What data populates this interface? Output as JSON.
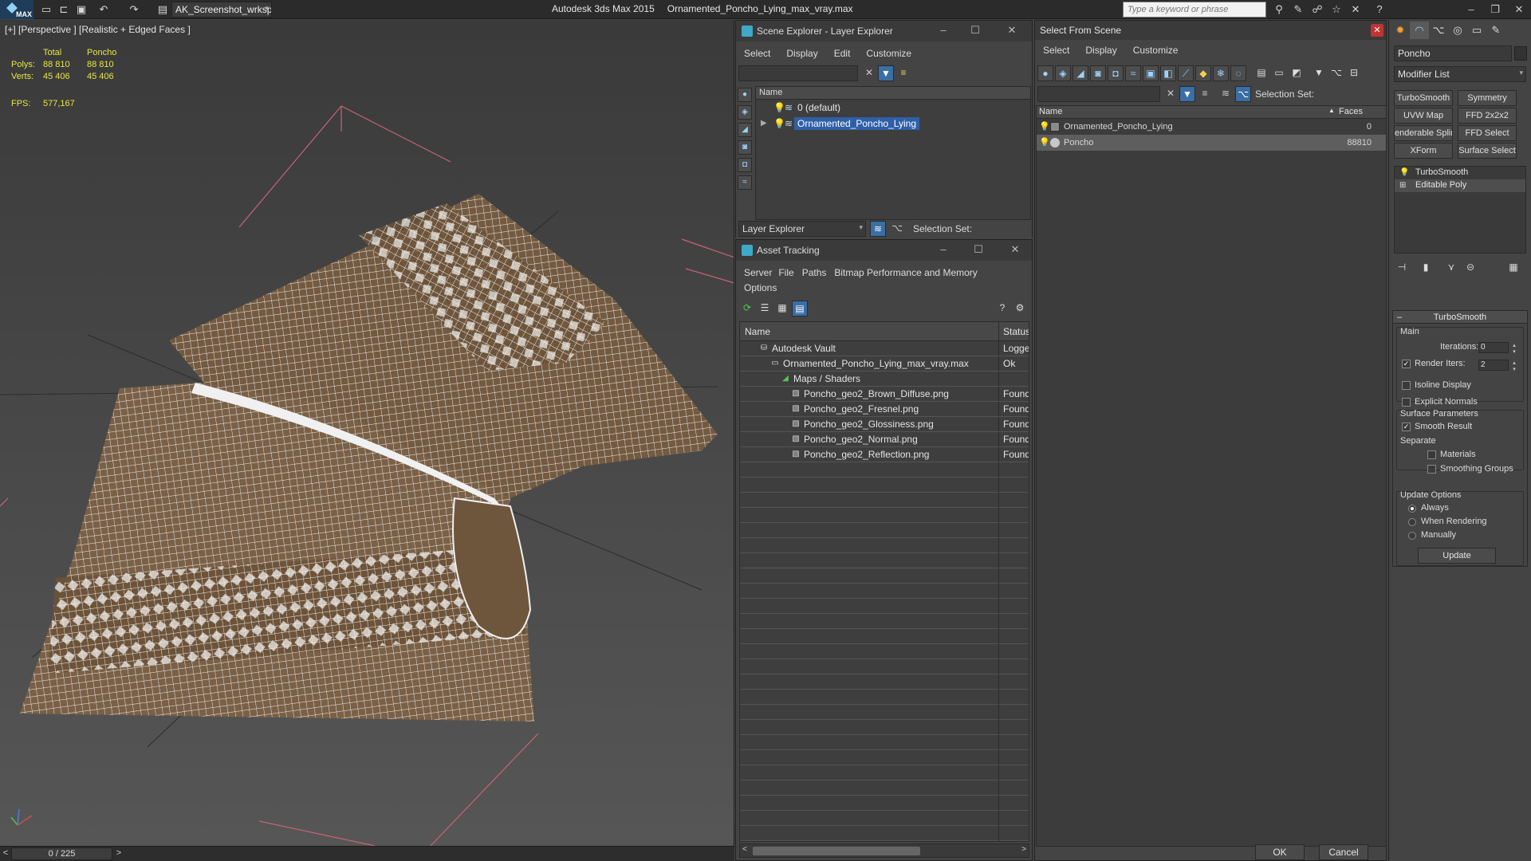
{
  "titlebar": {
    "workspace": "AK_Screenshot_wrksp",
    "app_name": "Autodesk 3ds Max  2015",
    "file_name": "Ornamented_Poncho_Lying_max_vray.max",
    "search_placeholder": "Type a keyword or phrase"
  },
  "viewport": {
    "label": "[+] [Perspective ] [Realistic + Edged Faces ]",
    "stats": {
      "col_total": "Total",
      "col_object": "Poncho",
      "polys_label": "Polys:",
      "polys_total": "88 810",
      "polys_object": "88 810",
      "verts_label": "Verts:",
      "verts_total": "45 406",
      "verts_object": "45 406",
      "fps_label": "FPS:",
      "fps_value": "577,167"
    },
    "time_slider": "0 / 225"
  },
  "scene_explorer": {
    "title": "Scene Explorer - Layer Explorer",
    "menu": [
      "Select",
      "Display",
      "Edit",
      "Customize"
    ],
    "col_name": "Name",
    "layers": [
      {
        "name": "0 (default)",
        "selected": false
      },
      {
        "name": "Ornamented_Poncho_Lying",
        "selected": true
      }
    ],
    "explorer_type": "Layer Explorer",
    "selection_set": "Selection Set:"
  },
  "asset_tracking": {
    "title": "Asset Tracking",
    "menu": [
      "Server",
      "File",
      "Paths",
      "Bitmap Performance and Memory",
      "Options"
    ],
    "col_name": "Name",
    "col_status": "Status",
    "rows": [
      {
        "name": "Autodesk Vault",
        "status": "Logge",
        "indent": 1,
        "icon": "vault-icon"
      },
      {
        "name": "Ornamented_Poncho_Lying_max_vray.max",
        "status": "Ok",
        "indent": 2,
        "icon": "max-file-icon"
      },
      {
        "name": "Maps / Shaders",
        "status": "",
        "indent": 3,
        "icon": "maps-icon"
      },
      {
        "name": "Poncho_geo2_Brown_Diffuse.png",
        "status": "Found",
        "indent": 4,
        "icon": "image-file-icon"
      },
      {
        "name": "Poncho_geo2_Fresnel.png",
        "status": "Found",
        "indent": 4,
        "icon": "image-file-icon"
      },
      {
        "name": "Poncho_geo2_Glossiness.png",
        "status": "Found",
        "indent": 4,
        "icon": "image-file-icon"
      },
      {
        "name": "Poncho_geo2_Normal.png",
        "status": "Found",
        "indent": 4,
        "icon": "image-file-icon"
      },
      {
        "name": "Poncho_geo2_Reflection.png",
        "status": "Found",
        "indent": 4,
        "icon": "image-file-icon"
      }
    ]
  },
  "select_from_scene": {
    "title": "Select From Scene",
    "menu": [
      "Select",
      "Display",
      "Customize"
    ],
    "selection_set": "Selection Set:",
    "col_name": "Name",
    "col_faces": "Faces",
    "rows": [
      {
        "name": "Ornamented_Poncho_Lying",
        "faces": "0",
        "selected": false
      },
      {
        "name": "Poncho",
        "faces": "88810",
        "selected": true
      }
    ],
    "ok_label": "OK",
    "cancel_label": "Cancel"
  },
  "command_panel": {
    "object_name": "Poncho",
    "modifier_list": "Modifier List",
    "modifier_buttons": [
      "TurboSmooth",
      "Symmetry",
      "UVW Map",
      "FFD 2x2x2",
      "enderable Splin",
      "FFD Select",
      "XForm",
      "Surface Select"
    ],
    "stack": [
      "TurboSmooth",
      "Editable Poly"
    ],
    "rollout": {
      "title": "TurboSmooth",
      "main": "Main",
      "iterations_label": "Iterations:",
      "iterations": "0",
      "render_iters_label": "Render Iters:",
      "render_iters": "2",
      "isoline": "Isoline Display",
      "explicit_normals": "Explicit Normals",
      "surface_params": "Surface Parameters",
      "smooth_result": "Smooth Result",
      "separate": "Separate",
      "materials": "Materials",
      "smoothing_groups": "Smoothing Groups",
      "update_options": "Update Options",
      "always": "Always",
      "when_rendering": "When Rendering",
      "manually": "Manually",
      "update": "Update"
    }
  }
}
